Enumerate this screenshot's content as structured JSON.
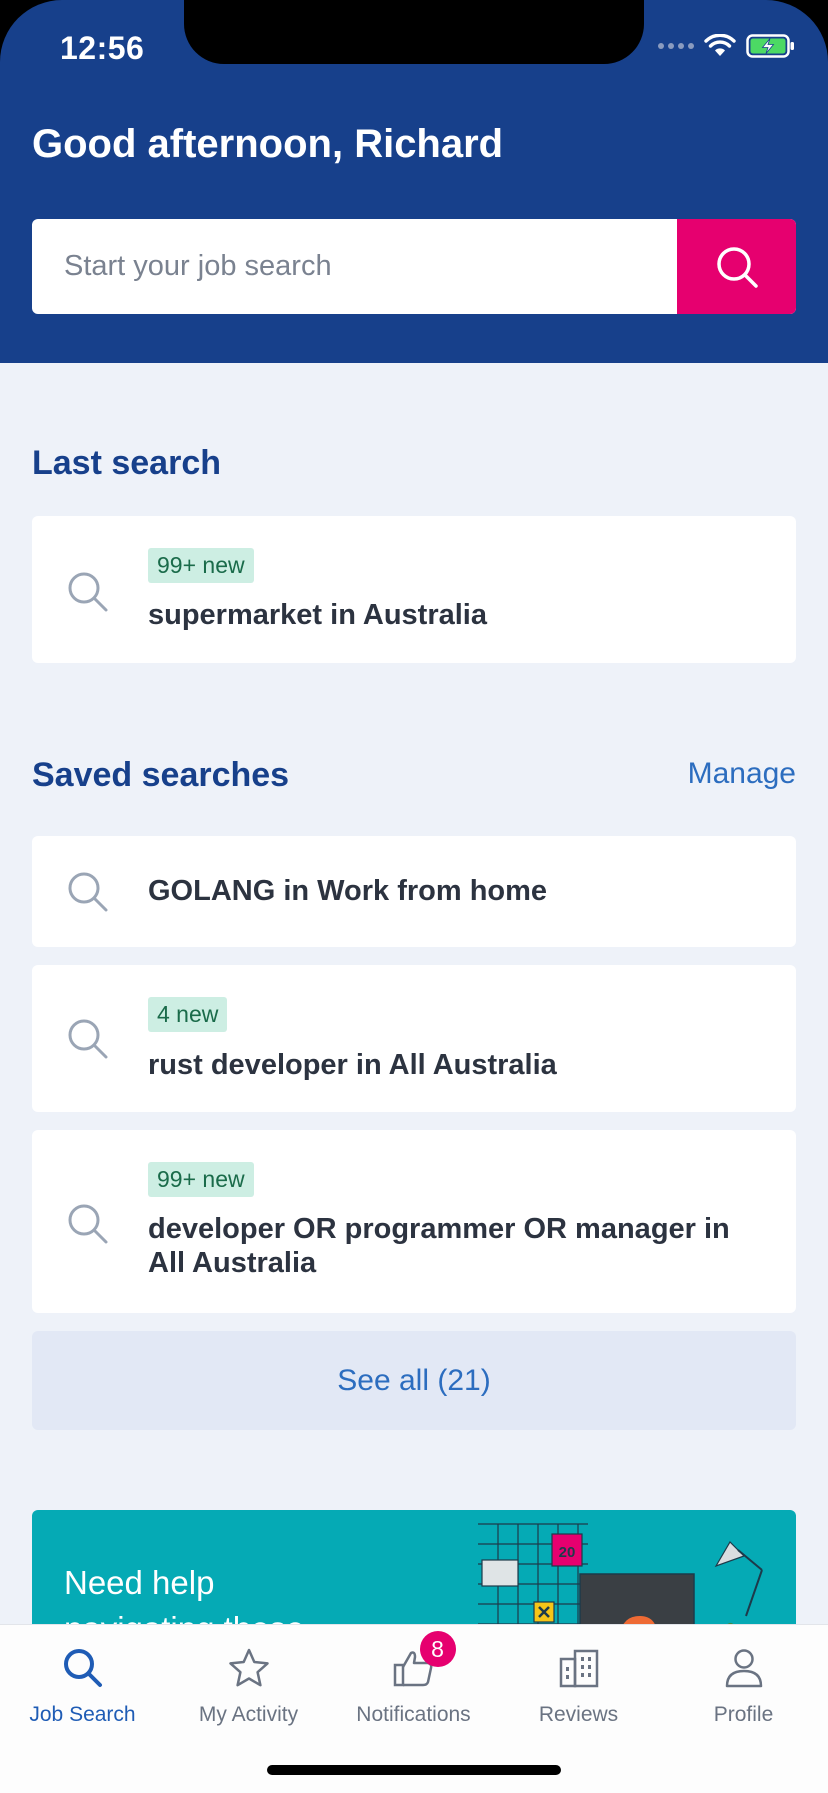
{
  "status_bar": {
    "time": "12:56"
  },
  "header": {
    "greeting": "Good afternoon, Richard",
    "search_placeholder": "Start your job search"
  },
  "last_search": {
    "title": "Last search",
    "item": {
      "badge": "99+ new",
      "label": "supermarket in Australia"
    }
  },
  "saved_searches": {
    "title": "Saved searches",
    "manage_label": "Manage",
    "items": [
      {
        "badge": "",
        "label": "GOLANG in Work from home"
      },
      {
        "badge": "4 new",
        "label": "rust developer in All Australia"
      },
      {
        "badge": "99+ new",
        "label": "developer OR programmer OR manager in All Australia"
      }
    ],
    "see_all_label": "See all (21)"
  },
  "promo": {
    "text": "Need help navigating these",
    "calendar_number": "20"
  },
  "tabbar": {
    "tabs": [
      {
        "label": "Job Search",
        "icon": "search-icon",
        "active": true
      },
      {
        "label": "My Activity",
        "icon": "star-icon"
      },
      {
        "label": "Notifications",
        "icon": "thumbs-up-icon",
        "badge": "8"
      },
      {
        "label": "Reviews",
        "icon": "building-icon"
      },
      {
        "label": "Profile",
        "icon": "person-icon"
      }
    ]
  },
  "colors": {
    "brand_blue": "#17408b",
    "accent_pink": "#e6006f",
    "link_blue": "#2c6dbf",
    "badge_green_bg": "#cdeee3",
    "promo_teal": "#05aab5"
  }
}
